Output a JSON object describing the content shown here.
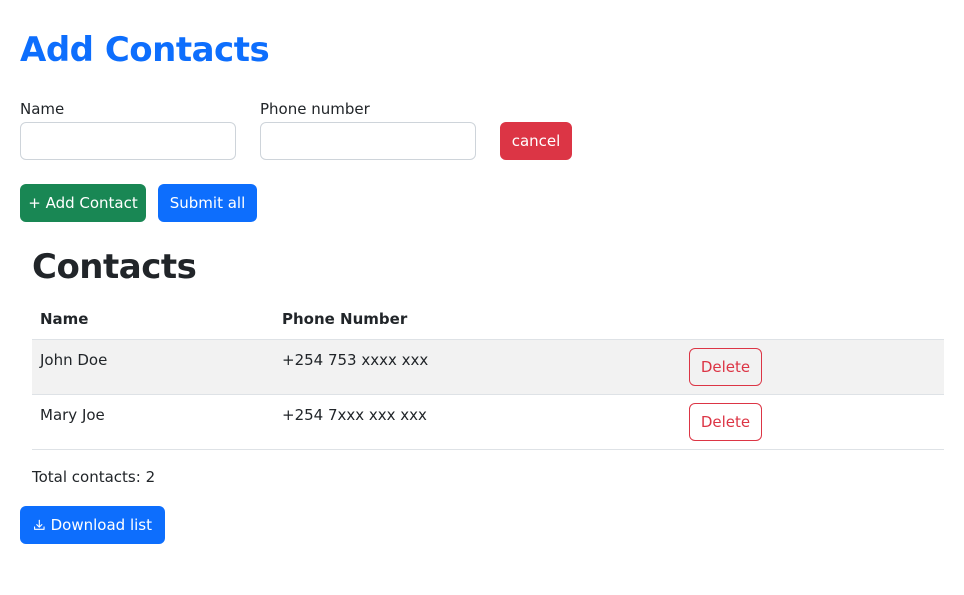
{
  "header": {
    "title": "Add Contacts"
  },
  "form": {
    "name_label": "Name",
    "name_value": "",
    "phone_label": "Phone number",
    "phone_value": "",
    "cancel_label": "cancel",
    "add_label": "+ Add Contact",
    "submit_label": "Submit all"
  },
  "contacts": {
    "title": "Contacts",
    "columns": [
      "Name",
      "Phone Number"
    ],
    "rows": [
      {
        "name": "John Doe",
        "phone": "+254 753 xxxx xxx",
        "action": "Delete"
      },
      {
        "name": "Mary Joe",
        "phone": "+254 7xxx xxx xxx",
        "action": "Delete"
      }
    ],
    "total": "Total contacts: 2"
  },
  "download": {
    "icon": "download-icon",
    "label": "Download list"
  },
  "colors": {
    "primary": "#0d6efd",
    "success": "#198754",
    "danger": "#dc3545",
    "stripe": "#f2f2f2"
  }
}
